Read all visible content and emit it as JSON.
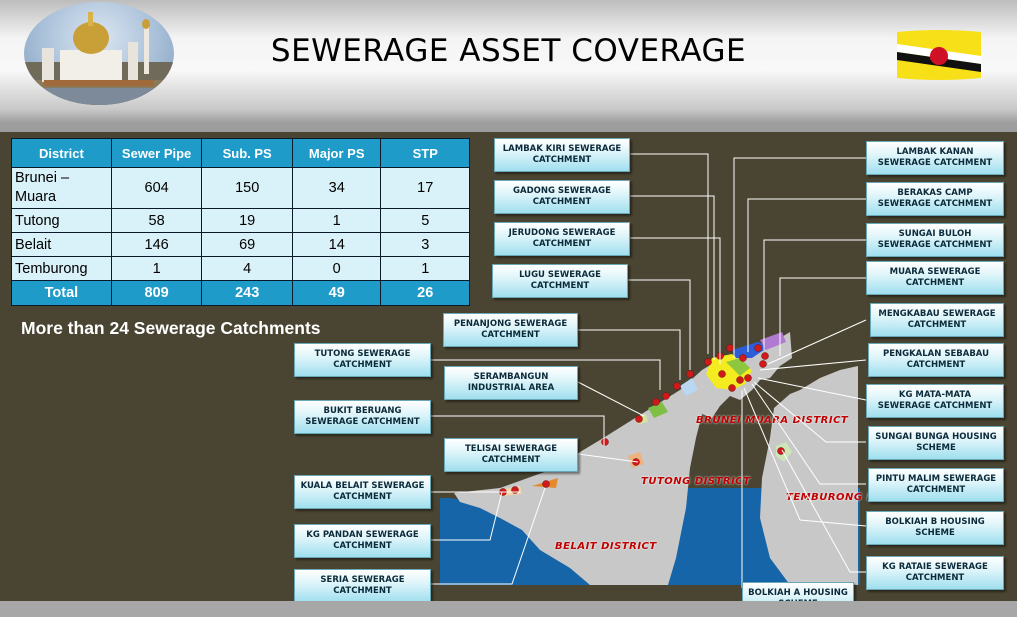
{
  "header": {
    "title": "SEWERAGE ASSET COVERAGE"
  },
  "table": {
    "columns": [
      "District",
      "Sewer Pipe",
      "Sub. PS",
      "Major PS",
      "STP"
    ],
    "rows": [
      {
        "district": "Brunei – Muara",
        "pipe": "604",
        "sub": "150",
        "major": "34",
        "stp": "17"
      },
      {
        "district": "Tutong",
        "pipe": "58",
        "sub": "19",
        "major": "1",
        "stp": "5"
      },
      {
        "district": "Belait",
        "pipe": "146",
        "sub": "69",
        "major": "14",
        "stp": "3"
      },
      {
        "district": "Temburong",
        "pipe": "1",
        "sub": "4",
        "major": "0",
        "stp": "1"
      }
    ],
    "total": {
      "district": "Total",
      "pipe": "809",
      "sub": "243",
      "major": "49",
      "stp": "26"
    }
  },
  "note": "More than 24 Sewerage Catchments",
  "districts": {
    "brunei": "BRUNEI MUARA DISTRICT",
    "tutong": "TUTONG DISTRICT",
    "temburong": "TEMBURONG DISTRICT",
    "belait": "BELAIT DISTRICT"
  },
  "callouts": {
    "lambak_kiri": "LAMBAK KIRI SEWERAGE CATCHMENT",
    "gadong": "GADONG SEWERAGE CATCHMENT",
    "jerudong": "JERUDONG SEWERAGE CATCHMENT",
    "lugu": "LUGU SEWERAGE CATCHMENT",
    "penanjong": "PENANJONG SEWERAGE CATCHMENT",
    "tutong": "TUTONG SEWERAGE CATCHMENT",
    "serambangun": "SERAMBANGUN INDUSTRIAL AREA",
    "bukit_beruang": "BUKIT BERUANG SEWERAGE CATCHMENT",
    "telisai": "TELISAI SEWERAGE CATCHMENT",
    "kuala_belait": "KUALA BELAIT SEWERAGE CATCHMENT",
    "kg_pandan": "KG PANDAN SEWERAGE CATCHMENT",
    "seria": "SERIA SEWERAGE CATCHMENT",
    "lambak_kanan": "LAMBAK KANAN SEWERAGE CATCHMENT",
    "berakas": "BERAKAS CAMP SEWERAGE CATCHMENT",
    "sungai_buloh": "SUNGAI BULOH SEWERAGE CATCHMENT",
    "muara": "MUARA SEWERAGE CATCHMENT",
    "mengkabau": "MENGKABAU SEWERAGE CATCHMENT",
    "pengkalan": "PENGKALAN SEBABAU CATCHMENT",
    "mata_mata": "KG MATA-MATA SEWERAGE CATCHMENT",
    "sungai_bunga": "SUNGAI BUNGA HOUSING SCHEME",
    "pintu_malim": "PINTU MALIM SEWERAGE CATCHMENT",
    "bolkiah_b": "BOLKIAH B HOUSING SCHEME",
    "kg_rataie": "KG RATAIE SEWERAGE CATCHMENT",
    "bolkiah_a": "BOLKIAH A HOUSING SCHEME"
  },
  "colors": {
    "header_fill": "#1f9bc9",
    "cell_fill": "#d9f1f8",
    "background": "#4a4532",
    "sea": "#1565a8",
    "land": "#c8c8c8",
    "district_text": "#c00000"
  },
  "icons": [
    "mosque-image",
    "brunei-flag-image"
  ]
}
